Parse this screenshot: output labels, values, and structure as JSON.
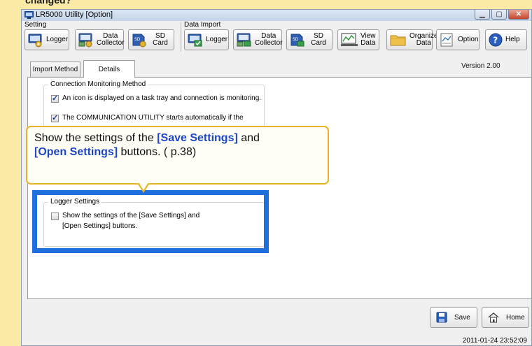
{
  "banner": {
    "partial_text": "changed?"
  },
  "window": {
    "title": "LR5000 Utility [Option]"
  },
  "toolbar": {
    "setting_group": "Setting",
    "data_import_group": "Data Import",
    "setting_logger": "Logger",
    "setting_collector": "Data\nCollector",
    "setting_sdcard": "SD Card",
    "import_logger": "Logger",
    "import_collector": "Data\nCollector",
    "import_sdcard": "SD Card",
    "view_data": "View\nData",
    "organize_data": "Organize\nData",
    "option": "Option",
    "help": "Help"
  },
  "tabs": {
    "import_method": "Import Method",
    "details": "Details",
    "version": "Version   2.00"
  },
  "connection": {
    "legend": "Connection Monitoring Method",
    "option1": "An icon is displayed on a task tray and connection is monitoring.",
    "option2": "The COMMUNICATION UTILITY starts automatically if the",
    "option1_checked": true,
    "option2_checked": true
  },
  "logger_settings": {
    "legend": "Logger Settings",
    "line1": "Show the settings of the [Save Settings] and",
    "line2": "[Open Settings] buttons.",
    "checked": false
  },
  "callout": {
    "part1": "Show the settings of the ",
    "bold1": "[Save Settings]",
    "part2": " and",
    "bold2": "[Open Settings]",
    "part3": " buttons. ( p.38)"
  },
  "bottom": {
    "save": "Save",
    "home": "Home",
    "timestamp": "2011-01-24 23:52:09"
  },
  "colors": {
    "banner": "#fbe9a6",
    "highlight": "#1f6fdc",
    "callout_border": "#e8b327",
    "callout_bold": "#1c46c7"
  }
}
